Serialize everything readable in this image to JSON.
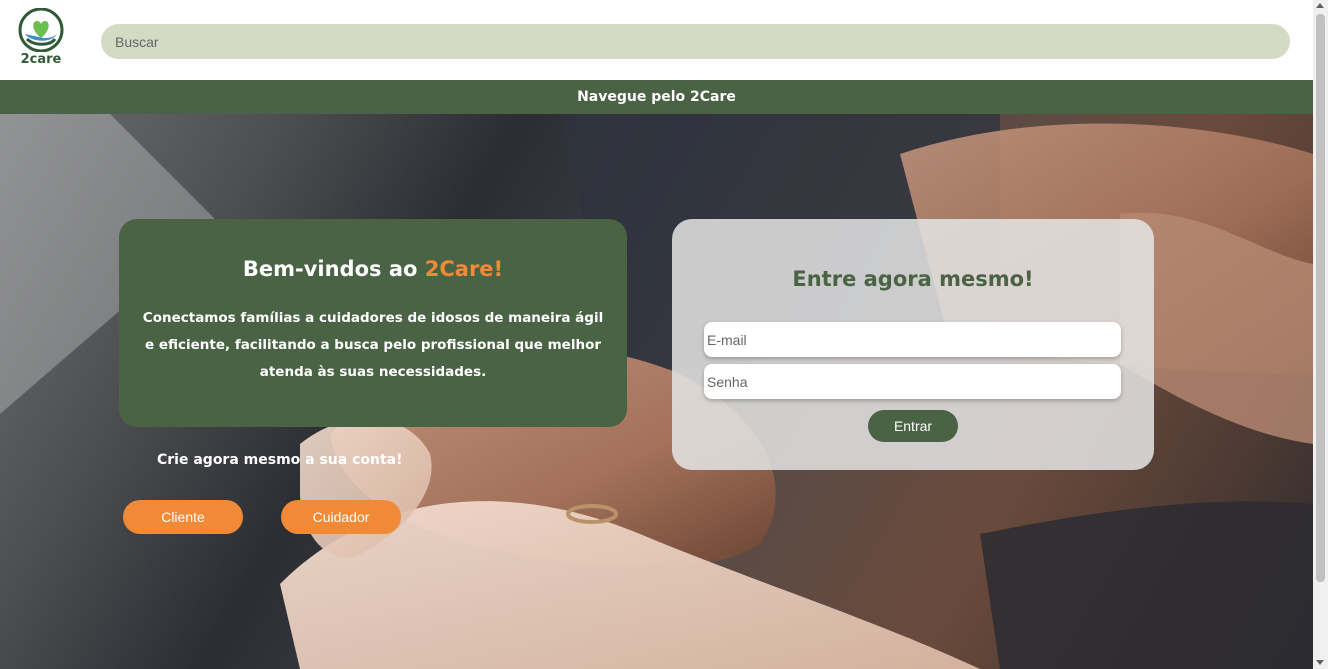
{
  "logo": {
    "text": "2care"
  },
  "search": {
    "placeholder": "Buscar"
  },
  "nav": {
    "label": "Navegue pelo 2Care"
  },
  "welcome": {
    "title_prefix": "Bem-vindos ao ",
    "title_brand": "2Care!",
    "description": "Conectamos famílias a cuidadores de idosos de maneira ágil e eficiente, facilitando a busca pelo profissional que melhor atenda às suas necessidades."
  },
  "signup": {
    "prompt": "Crie agora mesmo a sua conta!",
    "client_label": "Cliente",
    "caregiver_label": "Cuidador"
  },
  "login": {
    "title": "Entre agora mesmo!",
    "email_placeholder": "E-mail",
    "password_placeholder": "Senha",
    "submit_label": "Entrar"
  },
  "colors": {
    "brand_green": "#4a6344",
    "accent_orange": "#f08a36",
    "search_bg": "#d3dbc5"
  },
  "icons": {
    "logo": "heart-hands-logo-icon"
  }
}
